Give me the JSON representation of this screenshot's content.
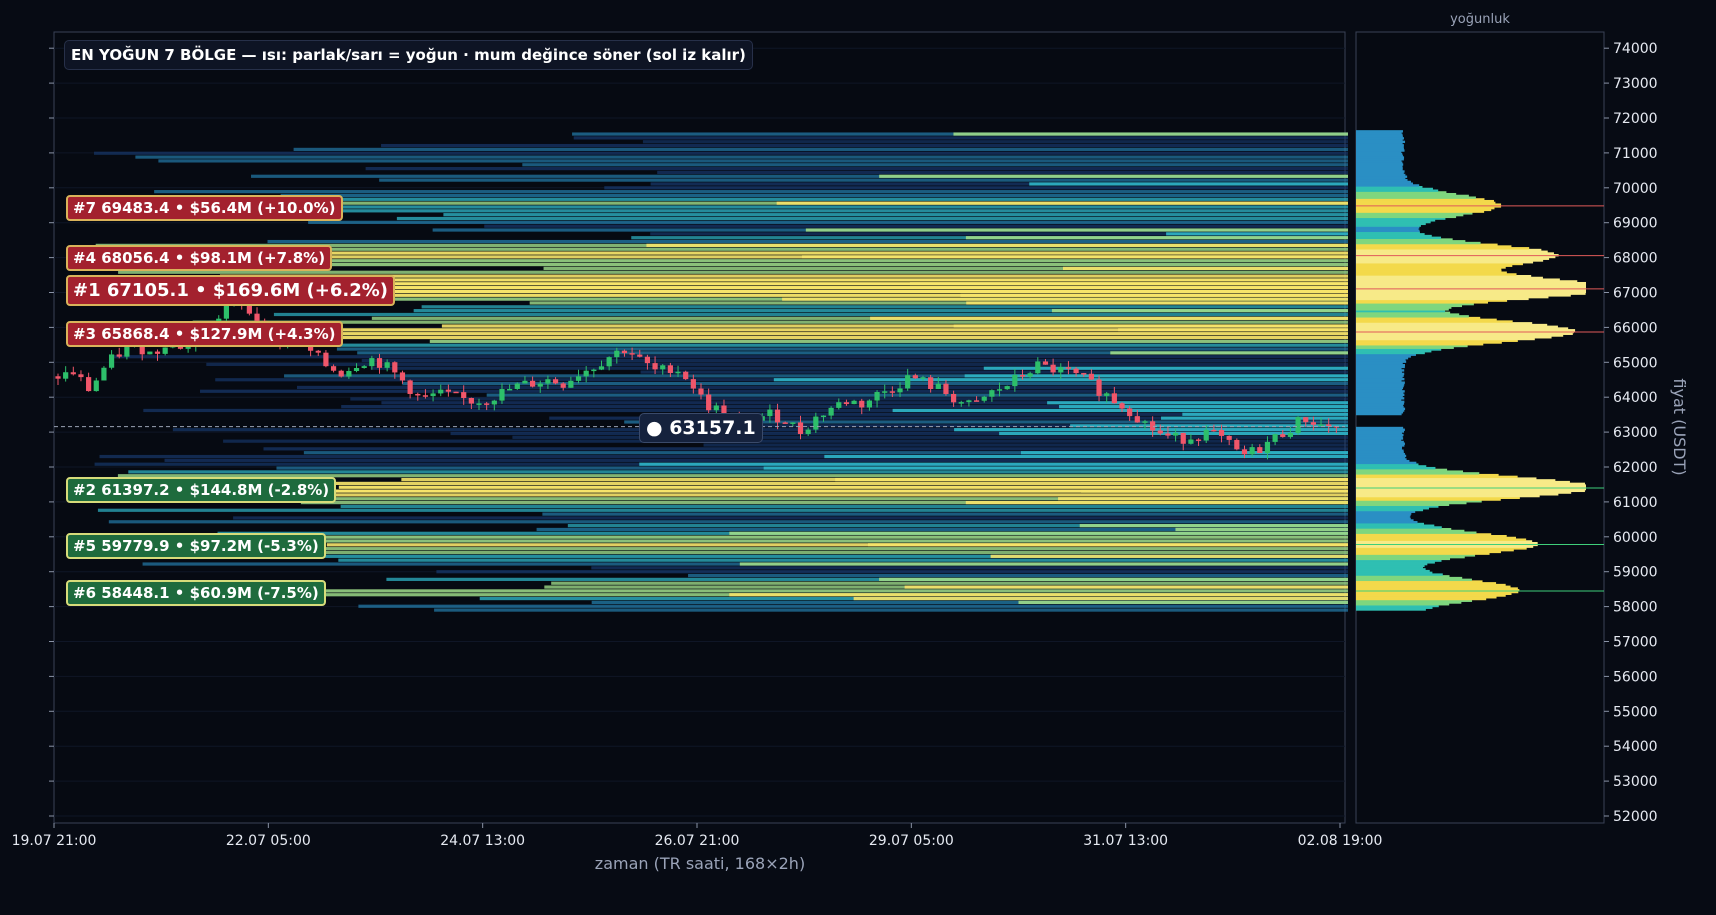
{
  "title": "EN YOĞUN 7 BÖLGE — ısı: parlak/sarı = yoğun · mum değince söner (sol iz kalır)",
  "current_price_label": "● 63157.1",
  "chart_data": [
    {
      "type": "candlestick_heatmap",
      "xlabel": "zaman (TR saati, 168×2h)",
      "ylabel": "fiyat (USDT)",
      "ylim": [
        52000,
        74000
      ],
      "yticks": [
        "52000",
        "53000",
        "54000",
        "55000",
        "56000",
        "57000",
        "58000",
        "59000",
        "60000",
        "61000",
        "62000",
        "63000",
        "64000",
        "65000",
        "66000",
        "67000",
        "68000",
        "69000",
        "70000",
        "71000",
        "72000",
        "73000",
        "74000"
      ],
      "xticks": [
        "19.07 21:00",
        "22.07 05:00",
        "24.07 13:00",
        "26.07 21:00",
        "29.07 05:00",
        "31.07 13:00",
        "02.08 19:00"
      ],
      "current_price": 63157.1,
      "price_path": [
        64600,
        64700,
        64200,
        64900,
        65300,
        65500,
        65200,
        65700,
        65400,
        65800,
        66200,
        66800,
        66500,
        66100,
        65600,
        65800,
        65300,
        64900,
        64700,
        65000,
        65100,
        64800,
        64400,
        63900,
        64100,
        64000,
        63900,
        63900,
        64100,
        64300,
        64400,
        64500,
        64400,
        64700,
        64900,
        65200,
        65400,
        65000,
        64700,
        64900,
        64500,
        63800,
        63600,
        63200,
        63400,
        63500,
        63400,
        63000,
        63400,
        63700,
        63900,
        63800,
        64100,
        64300,
        64600,
        64400,
        64200,
        63900,
        63700,
        64100,
        64300,
        64600,
        64900,
        64800,
        64700,
        64500,
        64200,
        63900,
        63600,
        63200,
        62900,
        62800,
        62900,
        63000,
        62700,
        62300,
        62500,
        62800,
        63100,
        63400,
        63200,
        63157
      ],
      "zones": [
        {
          "rank": 1,
          "label": "#1  67105.1  •  $169.6M  (+6.2%)",
          "price": 67105.1,
          "direction": "up"
        },
        {
          "rank": 2,
          "label": "#2  61397.2  •  $144.8M  (-2.8%)",
          "price": 61397.2,
          "direction": "down"
        },
        {
          "rank": 3,
          "label": "#3  65868.4  •  $127.9M  (+4.3%)",
          "price": 65868.4,
          "direction": "up"
        },
        {
          "rank": 4,
          "label": "#4  68056.4  •  $98.1M  (+7.8%)",
          "price": 68056.4,
          "direction": "up"
        },
        {
          "rank": 5,
          "label": "#5  59779.9  •  $97.2M  (-5.3%)",
          "price": 59779.9,
          "direction": "down"
        },
        {
          "rank": 6,
          "label": "#6  58448.1  •  $60.9M  (-7.5%)",
          "price": 58448.1,
          "direction": "down"
        },
        {
          "rank": 7,
          "label": "#7  69483.4  •  $56.4M  (+10.0%)",
          "price": 69483.4,
          "direction": "up"
        }
      ]
    },
    {
      "type": "horizontal_bar_profile",
      "title": "yoğunluk",
      "price_range": [
        57900,
        71600
      ],
      "peaks": [
        67105.1,
        61397.2,
        65868.4,
        68056.4,
        59779.9,
        58448.1,
        69483.4
      ]
    }
  ],
  "colors": {
    "background": "#070b14",
    "up_candle": "#2dbf6a",
    "down_candle": "#f0566a",
    "heat_low": "#1a3f7a",
    "heat_mid": "#2fb6c8",
    "heat_high": "#f6e46a",
    "axis": "#3a4256"
  }
}
